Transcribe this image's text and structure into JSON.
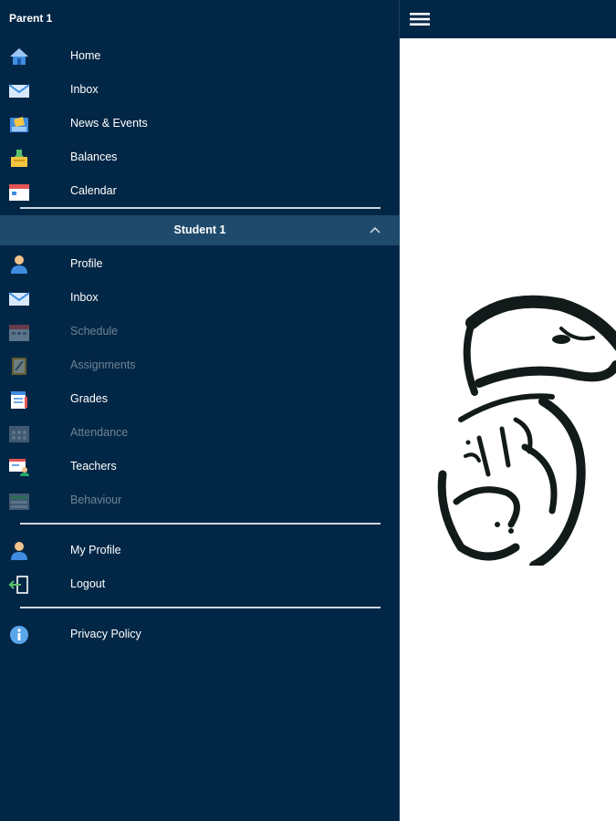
{
  "drawer": {
    "title": "Parent 1",
    "parent_items": [
      {
        "label": "Home",
        "icon": "home-icon"
      },
      {
        "label": "Inbox",
        "icon": "mail-icon"
      },
      {
        "label": "News & Events",
        "icon": "news-icon"
      },
      {
        "label": "Balances",
        "icon": "balances-icon"
      },
      {
        "label": "Calendar",
        "icon": "calendar-icon"
      }
    ],
    "student_section": {
      "label": "Student 1",
      "expanded": true
    },
    "student_items": [
      {
        "label": "Profile",
        "icon": "profile-icon",
        "enabled": true
      },
      {
        "label": "Inbox",
        "icon": "mail-icon",
        "enabled": true
      },
      {
        "label": "Schedule",
        "icon": "schedule-icon",
        "enabled": false
      },
      {
        "label": "Assignments",
        "icon": "assignments-icon",
        "enabled": false
      },
      {
        "label": "Grades",
        "icon": "grades-icon",
        "enabled": true
      },
      {
        "label": "Attendance",
        "icon": "attendance-icon",
        "enabled": false
      },
      {
        "label": "Teachers",
        "icon": "teachers-icon",
        "enabled": true
      },
      {
        "label": "Behaviour",
        "icon": "behaviour-icon",
        "enabled": false
      }
    ],
    "account_items": [
      {
        "label": "My Profile",
        "icon": "profile-icon"
      },
      {
        "label": "Logout",
        "icon": "logout-icon"
      }
    ],
    "footer_items": [
      {
        "label": "Privacy Policy",
        "icon": "info-icon"
      }
    ]
  },
  "topbar": {
    "menu_icon": "hamburger-icon"
  },
  "colors": {
    "drawer_bg": "#022746",
    "section_bg": "#1f4a6b",
    "text": "#ffffff",
    "disabled_text": "#6f8294"
  }
}
